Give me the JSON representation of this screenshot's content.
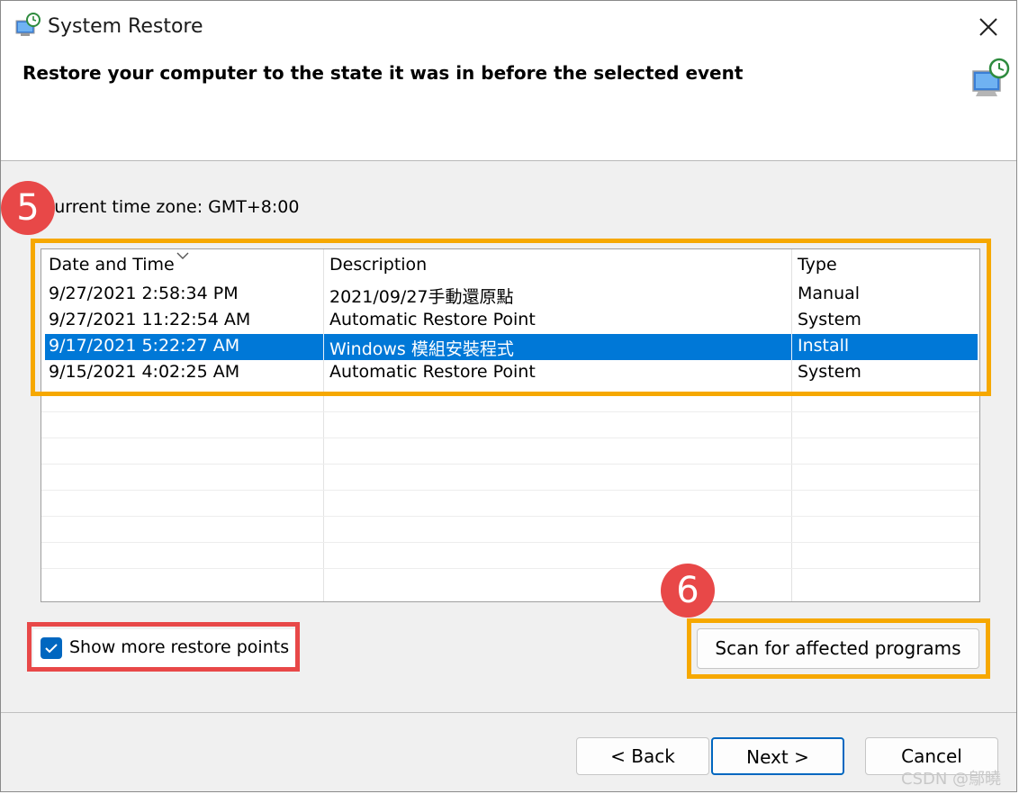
{
  "window": {
    "title": "System Restore",
    "heading": "Restore your computer to the state it was in before the selected event"
  },
  "timezone_label": "Current time zone: GMT+8:00",
  "annotations": {
    "step_a": "5",
    "step_b": "6"
  },
  "table": {
    "columns": [
      "Date and Time",
      "Description",
      "Type"
    ],
    "rows": [
      {
        "date": "9/27/2021 2:58:34 PM",
        "description": "2021/09/27手動還原點",
        "type": "Manual",
        "selected": false
      },
      {
        "date": "9/27/2021 11:22:54 AM",
        "description": "Automatic Restore Point",
        "type": "System",
        "selected": false
      },
      {
        "date": "9/17/2021 5:22:27 AM",
        "description": "Windows 模組安裝程式",
        "type": "Install",
        "selected": true
      },
      {
        "date": "9/15/2021 4:02:25 AM",
        "description": "Automatic Restore Point",
        "type": "System",
        "selected": false
      }
    ]
  },
  "show_more": {
    "label": "Show more restore points",
    "checked": true
  },
  "buttons": {
    "scan": "Scan for affected programs",
    "back": "< Back",
    "next": "Next >",
    "cancel": "Cancel"
  },
  "watermark": "CSDN @鄔曉",
  "colors": {
    "selection": "#0078d7",
    "highlight_orange": "#f6a800",
    "highlight_red": "#e84848",
    "badge": "#e84848",
    "accent": "#0067c0"
  },
  "icons": {
    "title": "system-restore-icon",
    "heading": "system-restore-icon",
    "close": "close-icon",
    "checkmark": "checkmark-icon",
    "sort": "sort-down-chevron-icon"
  }
}
